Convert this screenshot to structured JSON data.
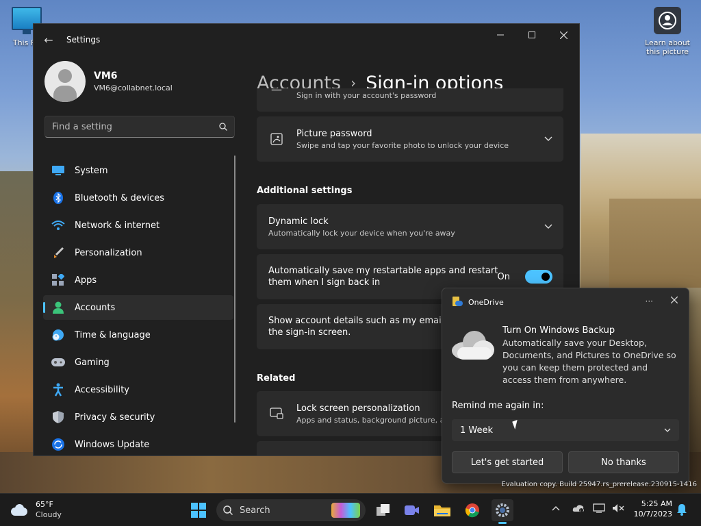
{
  "desktop": {
    "icons": [
      {
        "label": "This PC",
        "icon": "monitor-icon"
      },
      {
        "label": "Learn about this picture",
        "icon": "camera-icon"
      }
    ],
    "watermark": "Evaluation copy. Build 25947.rs_prerelease.230915-1416"
  },
  "settings": {
    "title": "Settings",
    "profile": {
      "name": "VM6",
      "email": "VM6@collabnet.local"
    },
    "search_placeholder": "Find a setting",
    "nav": [
      {
        "label": "System",
        "icon": "system-icon",
        "active": false
      },
      {
        "label": "Bluetooth & devices",
        "icon": "bluetooth-icon",
        "active": false
      },
      {
        "label": "Network & internet",
        "icon": "wifi-icon",
        "active": false
      },
      {
        "label": "Personalization",
        "icon": "brush-icon",
        "active": false
      },
      {
        "label": "Apps",
        "icon": "apps-icon",
        "active": false
      },
      {
        "label": "Accounts",
        "icon": "person-icon",
        "active": true
      },
      {
        "label": "Time & language",
        "icon": "clock-globe-icon",
        "active": false
      },
      {
        "label": "Gaming",
        "icon": "gamepad-icon",
        "active": false
      },
      {
        "label": "Accessibility",
        "icon": "accessibility-icon",
        "active": false
      },
      {
        "label": "Privacy & security",
        "icon": "shield-icon",
        "active": false
      },
      {
        "label": "Windows Update",
        "icon": "update-icon",
        "active": false
      }
    ],
    "breadcrumb": {
      "parent": "Accounts",
      "separator": "›",
      "current": "Sign-in options"
    },
    "cards": {
      "password_partial_sub": "Sign in with your account's password",
      "picture_password": {
        "title": "Picture password",
        "sub": "Swipe and tap your favorite photo to unlock your device"
      },
      "additional_heading": "Additional settings",
      "dynamic_lock": {
        "title": "Dynamic lock",
        "sub": "Automatically lock your device when you're away"
      },
      "restart_apps": {
        "line1": "Automatically save my restartable apps and restart",
        "line2": "them when I sign back in",
        "toggle_label": "On",
        "toggle_on": true
      },
      "account_details": {
        "line1": "Show account details such as my email address on",
        "line2": "the sign-in screen."
      },
      "related_heading": "Related",
      "lock_screen": {
        "title": "Lock screen personalization",
        "sub": "Apps and status, background picture, animations"
      }
    }
  },
  "toast": {
    "app": "OneDrive",
    "more": "···",
    "title": "Turn On Windows Backup",
    "body": "Automatically save your Desktop, Documents, and Pictures to OneDrive so you can keep them protected and access them from anywhere.",
    "remind_label": "Remind me again in:",
    "remind_value": "1 Week",
    "primary_button": "Let's get started",
    "secondary_button": "No thanks"
  },
  "taskbar": {
    "weather": {
      "temp": "65°F",
      "condition": "Cloudy"
    },
    "search_label": "Search",
    "pinned": [
      "start-icon",
      "search-box",
      "task-view-icon",
      "teams-icon",
      "file-explorer-icon",
      "chrome-icon",
      "settings-icon"
    ],
    "clock": {
      "time": "5:25 AM",
      "date": "10/7/2023"
    },
    "colors": {
      "accent": "#4cc2ff",
      "bar": "#1c1c1c"
    }
  }
}
